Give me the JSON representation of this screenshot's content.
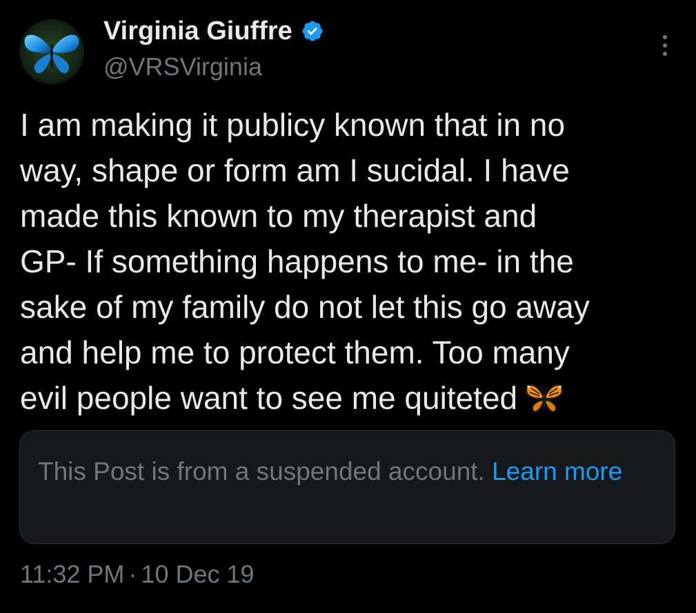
{
  "author": {
    "display_name": "Virginia Giuffre",
    "handle": "@VRSVirginia",
    "verified": true,
    "avatar_icon": "blue-butterfly-avatar"
  },
  "menu_icon": "more-vertical-icon",
  "tweet": {
    "lines": [
      "I am making it publicy known that in no",
      "way, shape or form am I sucidal. I have",
      "made this known to my therapist and",
      "GP- If something happens to me- in the",
      "sake of my family do not let this go away",
      "and help me to protect them. Too many",
      "evil people want to see me quiteted"
    ],
    "emoji": "🦋",
    "emoji_icon": "butterfly-emoji-icon"
  },
  "notice": {
    "text": "This Post is from a suspended account. ",
    "link_label": "Learn more"
  },
  "timestamp": {
    "time": "11:32 PM",
    "separator": "·",
    "date": "10 Dec 19"
  },
  "colors": {
    "background": "#000000",
    "text_primary": "#e7e9ea",
    "text_secondary": "#71767b",
    "accent": "#1d9bf0",
    "notice_background": "#16181c"
  }
}
